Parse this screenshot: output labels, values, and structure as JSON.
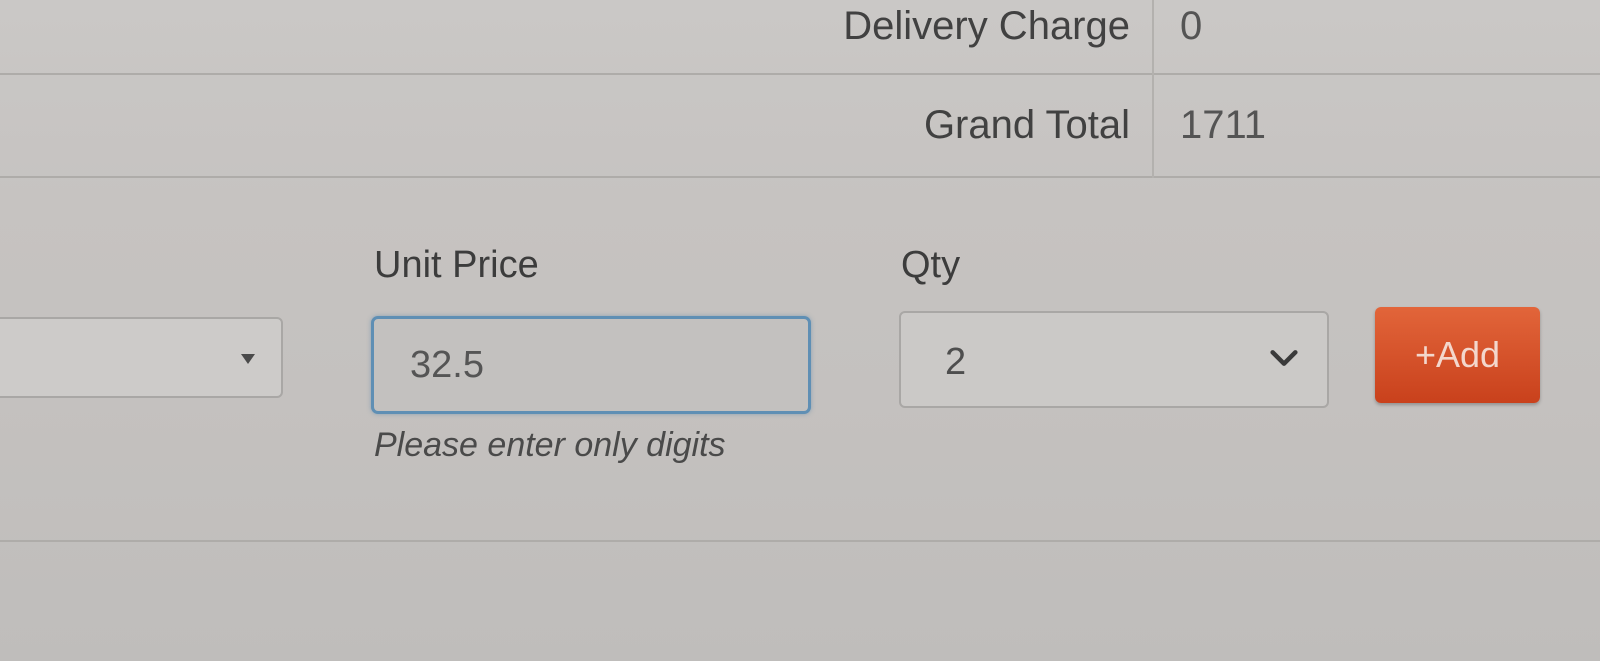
{
  "summary": {
    "rows": [
      {
        "label": "Delivery Charge",
        "value": "0"
      },
      {
        "label": "Grand Total",
        "value": "1711"
      }
    ]
  },
  "form": {
    "unit_price": {
      "label": "Unit Price",
      "value": "32.5",
      "help_text": "Please enter only digits"
    },
    "qty": {
      "label": "Qty",
      "selected": "2"
    },
    "add_button": {
      "label": "+Add"
    },
    "product_select": {
      "selected": ""
    }
  },
  "colors": {
    "add_button": "#d4512a",
    "focus_border": "#5f8fb4",
    "background": "#c8c6c4"
  },
  "icons": {
    "qty_dropdown": "chevron-down-icon",
    "product_dropdown": "caret-down-icon"
  }
}
